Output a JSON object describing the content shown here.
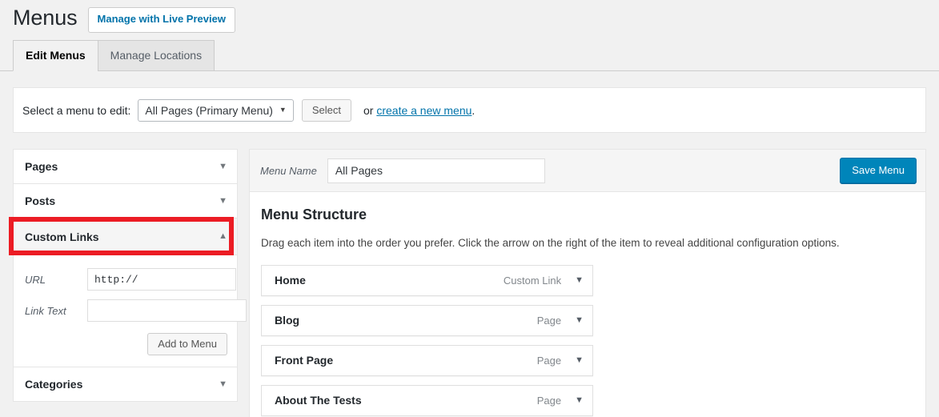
{
  "header": {
    "title": "Menus",
    "live_preview_label": "Manage with Live Preview"
  },
  "tabs": [
    {
      "label": "Edit Menus",
      "active": true
    },
    {
      "label": "Manage Locations",
      "active": false
    }
  ],
  "menu_select_bar": {
    "label": "Select a menu to edit:",
    "selected_menu": "All Pages (Primary Menu)",
    "dropdown_arrow": "chevron-down-icon",
    "select_button": "Select",
    "or_text": "or",
    "create_link": "create a new menu",
    "period": "."
  },
  "sidebar": {
    "panels": [
      {
        "title": "Pages",
        "expanded": false,
        "arrow": "chevron-down-icon"
      },
      {
        "title": "Posts",
        "expanded": false,
        "arrow": "chevron-down-icon"
      },
      {
        "title": "Custom Links",
        "expanded": true,
        "arrow": "chevron-up-icon",
        "highlighted": true
      },
      {
        "title": "Categories",
        "expanded": false,
        "arrow": "chevron-down-icon"
      }
    ],
    "custom_links": {
      "url_label": "URL",
      "url_value": "http://",
      "link_text_label": "Link Text",
      "link_text_value": "",
      "link_text_placeholder": "",
      "add_button": "Add to Menu"
    },
    "highlight_color": "#ec1c24"
  },
  "main": {
    "menu_name_label": "Menu Name",
    "menu_name_value": "All Pages",
    "save_button": "Save Menu",
    "save_button_color": "#0085ba",
    "structure_heading": "Menu Structure",
    "structure_description": "Drag each item into the order you prefer. Click the arrow on the right of the item to reveal additional configuration options.",
    "menu_items": [
      {
        "title": "Home",
        "type": "Custom Link",
        "arrow": "chevron-down-icon"
      },
      {
        "title": "Blog",
        "type": "Page",
        "arrow": "chevron-down-icon"
      },
      {
        "title": "Front Page",
        "type": "Page",
        "arrow": "chevron-down-icon"
      },
      {
        "title": "About The Tests",
        "type": "Page",
        "arrow": "chevron-down-icon"
      }
    ]
  }
}
